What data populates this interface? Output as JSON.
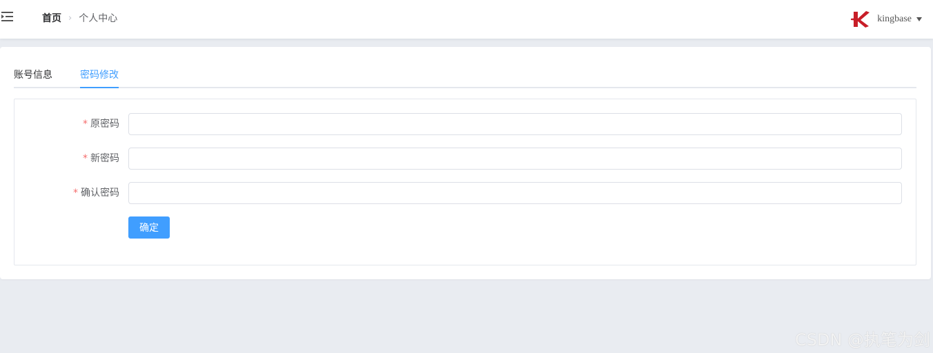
{
  "navbar": {
    "breadcrumb": {
      "home": "首页",
      "separator": "›",
      "current": "个人中心"
    },
    "user": {
      "name": "kingbase",
      "logo_color": "#c81e28"
    }
  },
  "tabs": [
    {
      "label": "账号信息",
      "active": false
    },
    {
      "label": "密码修改",
      "active": true
    }
  ],
  "form": {
    "required_mark": "*",
    "old_password": {
      "label": "原密码",
      "value": ""
    },
    "new_password": {
      "label": "新密码",
      "value": ""
    },
    "confirm_password": {
      "label": "确认密码",
      "value": ""
    },
    "submit_label": "确定"
  },
  "watermark": "CSDN @执笔为剑",
  "colors": {
    "primary": "#409eff",
    "required": "#f56c6c",
    "background": "#e9ecf1"
  }
}
